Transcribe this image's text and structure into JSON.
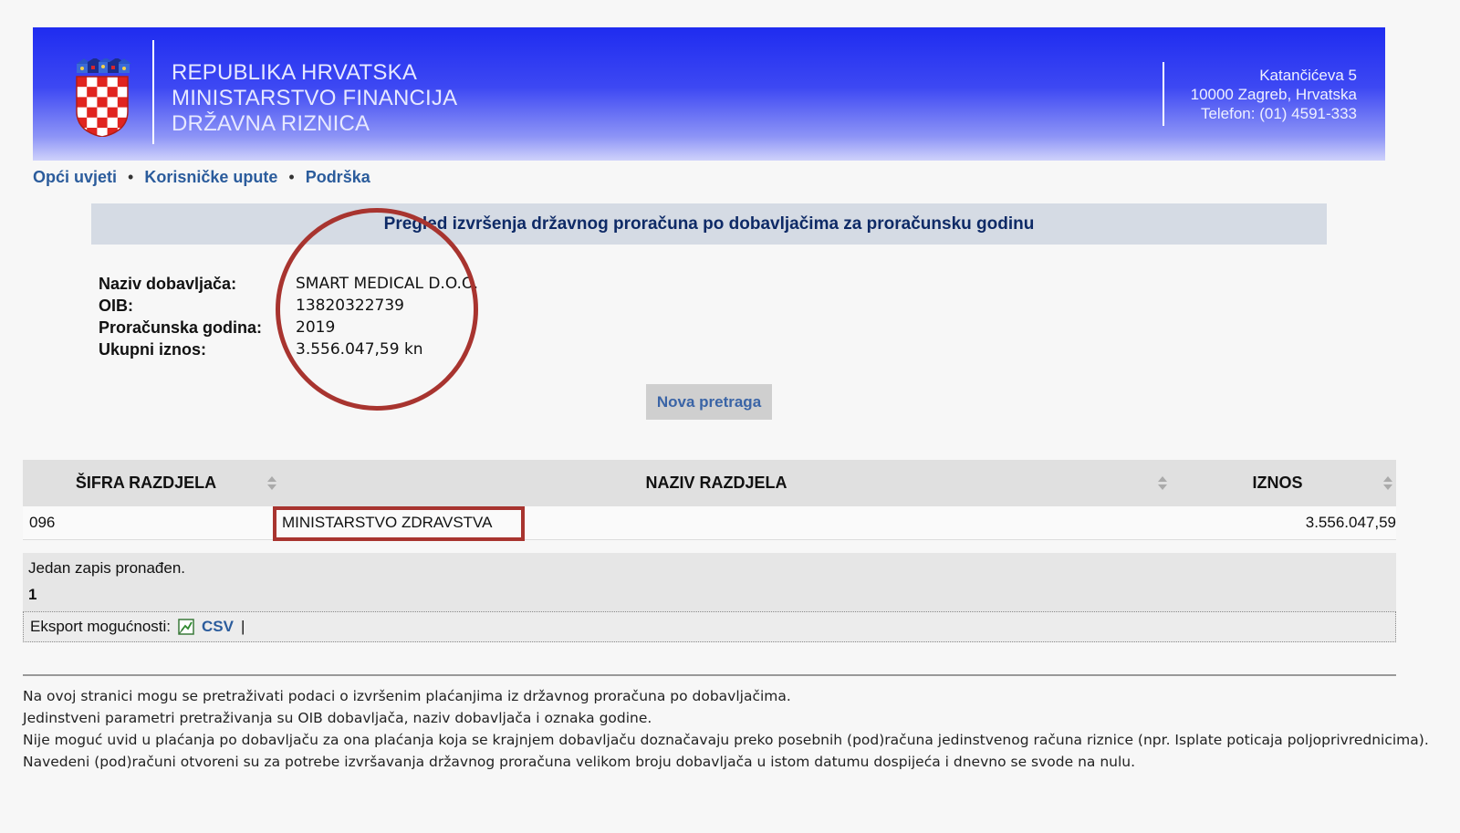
{
  "banner": {
    "line1": "REPUBLIKA HRVATSKA",
    "line2": "MINISTARSTVO FINANCIJA",
    "line3": "DRŽAVNA RIZNICA",
    "address1": "Katančićeva 5",
    "address2": "10000 Zagreb, Hrvatska",
    "address3": "Telefon: (01) 4591-333",
    "crest_icon": "croatian-coat-of-arms-icon"
  },
  "nav": [
    {
      "label": "Opći uvjeti"
    },
    {
      "label": "Korisničke upute"
    },
    {
      "label": "Podrška"
    }
  ],
  "page_title": "Pregled izvršenja državnog proračuna po dobavljačima za proračunsku godinu",
  "info": {
    "supplier_label": "Naziv dobavljača:",
    "supplier_value": "SMART MEDICAL D.O.O.",
    "oib_label": "OIB:",
    "oib_value": "13820322739",
    "year_label": "Proračunska godina:",
    "year_value": "2019",
    "total_label": "Ukupni iznos:",
    "total_value": "3.556.047,59 kn"
  },
  "new_search_label": "Nova pretraga",
  "table": {
    "headers": [
      "ŠIFRA RAZDJELA",
      "NAZIV RAZDJELA",
      "IZNOS"
    ],
    "rows": [
      [
        "096",
        "MINISTARSTVO ZDRAVSTVA",
        "3.556.047,59"
      ]
    ]
  },
  "summary": {
    "count_text": "Jedan zapis pronađen.",
    "page": "1"
  },
  "export": {
    "label": "Eksport mogućnosti:",
    "csv": "CSV",
    "separator": "|"
  },
  "footer": [
    "Na ovoj stranici mogu se pretraživati podaci o izvršenim plaćanjima iz državnog proračuna po dobavljačima.",
    "Jedinstveni parametri pretraživanja su OIB dobavljača, naziv dobavljača i oznaka godine.",
    "Nije moguć uvid u plaćanja po dobavljaču za ona plaćanja koja se krajnjem dobavljaču doznačavaju preko posebnih (pod)računa jedinstvenog računa riznice (npr. Isplate poticaja poljoprivrednicima).",
    "Navedeni (pod)računi otvoreni su za potrebe izvršavanja državnog proračuna velikom broju dobavljača u istom datumu dospijeća i dnevno se svode na nulu."
  ],
  "colors": {
    "annotation_red": "#a8342f",
    "link_blue": "#2b5c9c",
    "banner_blue": "#1f2cf0"
  }
}
